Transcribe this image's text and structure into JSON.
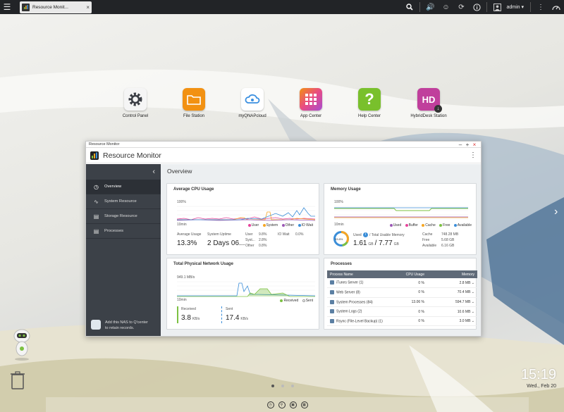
{
  "topbar": {
    "tab_label": "Resource Monit...",
    "user": "admin ▾",
    "icons": [
      "menu-icon",
      "search-icon",
      "volume-icon",
      "person-speech-icon",
      "sync-icon",
      "info-icon",
      "user-icon",
      "dashboard-icon"
    ]
  },
  "desktop": {
    "apps": [
      {
        "label": "Control Panel",
        "icon": "gear-icon",
        "color": "#3a3d44"
      },
      {
        "label": "File Station",
        "icon": "folder-icon",
        "color": "#f29112"
      },
      {
        "label": "myQNAPcloud",
        "icon": "cloud-icon",
        "color": "#ffffff"
      },
      {
        "label": "App Center",
        "icon": "grid-icon",
        "color": "#e94b83"
      },
      {
        "label": "Help Center",
        "icon": "question-icon",
        "color": "#79c02c"
      },
      {
        "label": "HybridDesk Station",
        "icon": "hd-icon",
        "color": "#c03f9c"
      }
    ],
    "clock_time": "15:19",
    "clock_date": "Wed., Feb 20"
  },
  "window": {
    "titlebar": "Resource Monitor",
    "title": "Resource Monitor",
    "section_title": "Overview",
    "nav": [
      {
        "label": "Overview",
        "icon": "gauge-icon"
      },
      {
        "label": "System Resource",
        "icon": "pulse-icon"
      },
      {
        "label": "Storage Resource",
        "icon": "storage-icon"
      },
      {
        "label": "Processes",
        "icon": "list-icon"
      }
    ],
    "qcenter": [
      "Add this NAS to Q'center",
      "to retain records."
    ]
  },
  "cpu": {
    "title": "Average CPU Usage",
    "y_top": "100%",
    "x_label": "10min",
    "legend": [
      "User",
      "System",
      "Other",
      "IO Wait"
    ],
    "avg_label": "Average Usage",
    "avg_value": "13.3%",
    "uptime_label": "System Uptime",
    "uptime_value": "2 Days 06...",
    "user_label": "User",
    "user_value": "9.8%",
    "sys_label": "Syst...",
    "sys_value": "2.8%",
    "other_label": "Other",
    "other_value": "0.8%",
    "io_label": "IO Wait",
    "io_value": "0.0%"
  },
  "memory": {
    "title": "Memory Usage",
    "y_top": "100%",
    "x_label": "10min",
    "legend": [
      "Used",
      "Buffer",
      "Cache",
      "Free",
      "Available"
    ],
    "pct": "33.8%",
    "used_label": "Used",
    "total_label": "/ Total Usable Memory",
    "used_value": "1.61",
    "used_unit": "GB",
    "total_value": "7.77",
    "total_unit": "GB",
    "cache_label": "Cache",
    "cache_value": "748.28 MB",
    "free_label": "Free",
    "free_value": "5.68 GB",
    "avail_label": "Available",
    "avail_value": "6.16 GB"
  },
  "network": {
    "title": "Total Physical Network Usage",
    "y_top": "949.1 MB/s",
    "x_label": "10min",
    "legend": [
      "Received",
      "Sent"
    ],
    "recv_label": "Received",
    "recv_value": "3.8",
    "recv_unit": "KB/s",
    "sent_label": "Sent",
    "sent_value": "17.4",
    "sent_unit": "KB/s"
  },
  "processes": {
    "title": "Processes",
    "columns": [
      "Process Name",
      "CPU Usage",
      "Memory"
    ],
    "rows": [
      {
        "name": "iTunes Server (1)",
        "cpu": "0 %",
        "mem": "2.8 MB"
      },
      {
        "name": "Web Server (8)",
        "cpu": "0 %",
        "mem": "70.4 MB"
      },
      {
        "name": "System Processes (84)",
        "cpu": "13.06 %",
        "mem": "594.7 MB"
      },
      {
        "name": "System Logs (2)",
        "cpu": "0 %",
        "mem": "10.6 MB"
      },
      {
        "name": "Rsync (File-Level Backup) (1)",
        "cpu": "0 %",
        "mem": "3.0 MB"
      }
    ]
  },
  "colors": {
    "user": "#e6449b",
    "system": "#f6a623",
    "other": "#9b59b6",
    "io_wait": "#3b8ed8",
    "used": "#9b59b6",
    "buffer": "#e6449b",
    "cache": "#f6a623",
    "free": "#7cc142",
    "available": "#3b8ed8",
    "received": "#7cc142",
    "sent": "#3b8ed8"
  }
}
